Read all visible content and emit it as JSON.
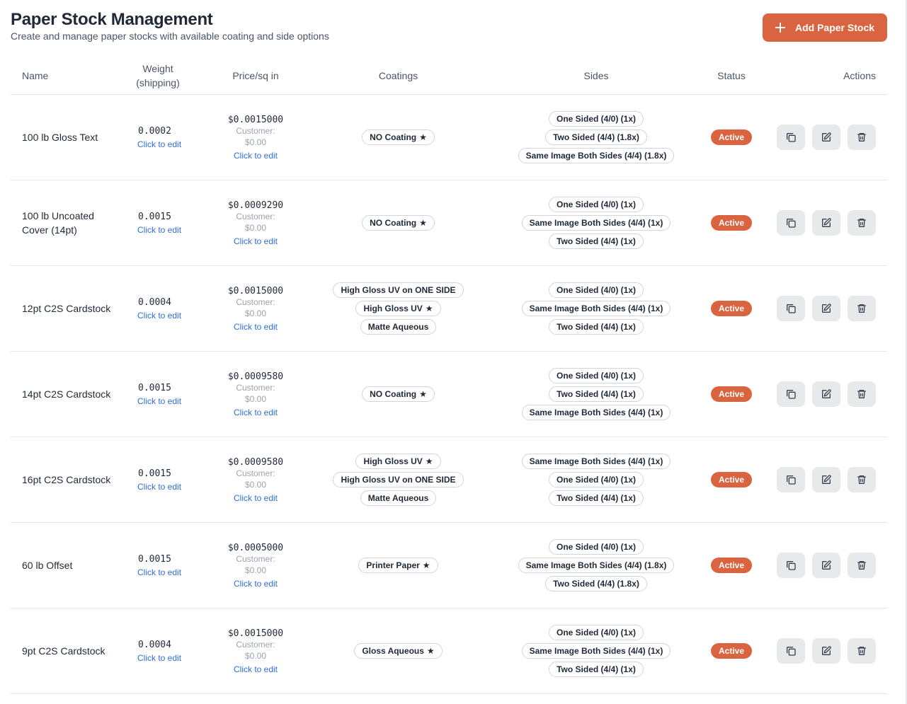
{
  "header": {
    "title": "Paper Stock Management",
    "subtitle": "Create and manage paper stocks with available coating and side options",
    "add_button_label": "Add Paper Stock"
  },
  "table": {
    "columns": {
      "name": "Name",
      "weight_line1": "Weight",
      "weight_line2": "(shipping)",
      "price": "Price/sq in",
      "coatings": "Coatings",
      "sides": "Sides",
      "status": "Status",
      "actions": "Actions"
    },
    "edit_link_label": "Click to edit",
    "customer_label": "Customer:",
    "rows": [
      {
        "name": "100 lb Gloss Text",
        "weight": "0.0002",
        "price": "$0.0015000",
        "customer_price": "$0.00",
        "coatings": [
          {
            "label": "NO Coating",
            "default": true
          }
        ],
        "sides": [
          "One Sided (4/0) (1x)",
          "Two Sided (4/4) (1.8x)",
          "Same Image Both Sides (4/4) (1.8x)"
        ],
        "status": "Active"
      },
      {
        "name": "100 lb Uncoated Cover (14pt)",
        "weight": "0.0015",
        "price": "$0.0009290",
        "customer_price": "$0.00",
        "coatings": [
          {
            "label": "NO Coating",
            "default": true
          }
        ],
        "sides": [
          "One Sided (4/0) (1x)",
          "Same Image Both Sides (4/4) (1x)",
          "Two Sided (4/4) (1x)"
        ],
        "status": "Active"
      },
      {
        "name": "12pt C2S Cardstock",
        "weight": "0.0004",
        "price": "$0.0015000",
        "customer_price": "$0.00",
        "coatings": [
          {
            "label": "High Gloss UV on ONE SIDE",
            "default": false
          },
          {
            "label": "High Gloss UV",
            "default": true
          },
          {
            "label": "Matte Aqueous",
            "default": false
          }
        ],
        "sides": [
          "One Sided (4/0) (1x)",
          "Same Image Both Sides (4/4) (1x)",
          "Two Sided (4/4) (1x)"
        ],
        "status": "Active"
      },
      {
        "name": "14pt C2S Cardstock",
        "weight": "0.0015",
        "price": "$0.0009580",
        "customer_price": "$0.00",
        "coatings": [
          {
            "label": "NO Coating",
            "default": true
          }
        ],
        "sides": [
          "One Sided (4/0) (1x)",
          "Two Sided (4/4) (1x)",
          "Same Image Both Sides (4/4) (1x)"
        ],
        "status": "Active"
      },
      {
        "name": "16pt C2S Cardstock",
        "weight": "0.0015",
        "price": "$0.0009580",
        "customer_price": "$0.00",
        "coatings": [
          {
            "label": "High Gloss UV",
            "default": true
          },
          {
            "label": "High Gloss UV on ONE SIDE",
            "default": false
          },
          {
            "label": "Matte Aqueous",
            "default": false
          }
        ],
        "sides": [
          "Same Image Both Sides (4/4) (1x)",
          "One Sided (4/0) (1x)",
          "Two Sided (4/4) (1x)"
        ],
        "status": "Active"
      },
      {
        "name": "60 lb Offset",
        "weight": "0.0015",
        "price": "$0.0005000",
        "customer_price": "$0.00",
        "coatings": [
          {
            "label": "Printer Paper",
            "default": true
          }
        ],
        "sides": [
          "One Sided (4/0) (1x)",
          "Same Image Both Sides (4/4) (1.8x)",
          "Two Sided (4/4) (1.8x)"
        ],
        "status": "Active"
      },
      {
        "name": "9pt C2S Cardstock",
        "weight": "0.0004",
        "price": "$0.0015000",
        "customer_price": "$0.00",
        "coatings": [
          {
            "label": "Gloss Aqueous",
            "default": true
          }
        ],
        "sides": [
          "One Sided (4/0) (1x)",
          "Same Image Both Sides (4/4) (1x)",
          "Two Sided (4/4) (1x)"
        ],
        "status": "Active"
      }
    ]
  },
  "colors": {
    "accent": "#d9643f",
    "link": "#2f6fd6",
    "action_button_bg": "#e8e9eb"
  },
  "icons": {
    "add": "plus-icon",
    "default_marker": "star-icon",
    "duplicate": "copy-icon",
    "edit": "edit-icon",
    "delete": "trash-icon"
  }
}
